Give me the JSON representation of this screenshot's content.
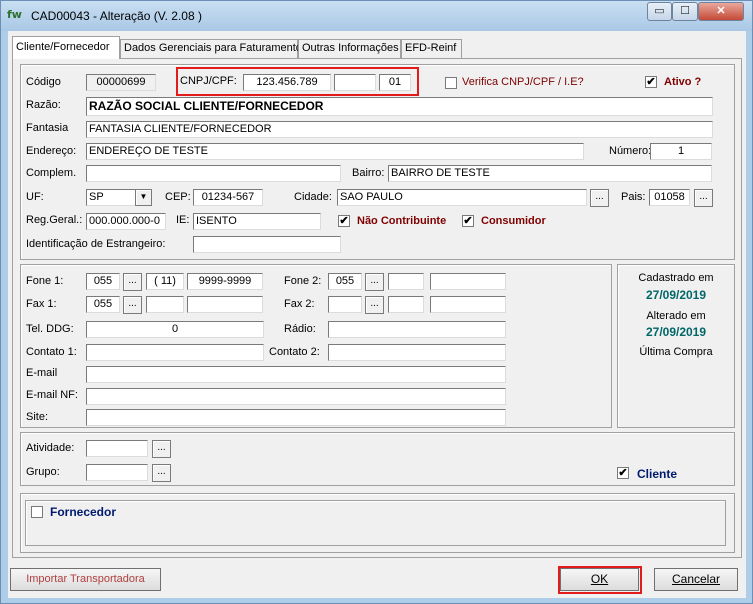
{
  "window": {
    "title": "CAD00043 - Alteração  (V.  2.08 )",
    "app_icon": "fw",
    "min": "▭",
    "max": "☐",
    "close": "✕"
  },
  "tabs": [
    "Cliente/Fornecedor",
    "Dados Gerenciais para Faturamento",
    "Outras Informações",
    "EFD-Reinf"
  ],
  "ident": {
    "codigo_label": "Código",
    "codigo": "00000699",
    "cnpj_label": "CNPJ/CPF:",
    "cnpj1": "123.456.789",
    "cnpj2": "",
    "cnpj3": "01",
    "verifica_label": "Verifica CNPJ/CPF / I.E?",
    "ativo_label": "Ativo ?",
    "razao_label": "Razão:",
    "razao": "RAZÃO SOCIAL CLIENTE/FORNECEDOR",
    "fantasia_label": "Fantasia",
    "fantasia": "FANTASIA CLIENTE/FORNECEDOR",
    "endereco_label": "Endereço:",
    "endereco": "ENDEREÇO DE TESTE",
    "numero_label": "Número:",
    "numero": "1",
    "complem_label": "Complem.",
    "complem": "",
    "bairro_label": "Bairro:",
    "bairro": "BAIRRO DE TESTE",
    "uf_label": "UF:",
    "uf": "SP",
    "cep_label": "CEP:",
    "cep": "01234-567",
    "cidade_label": "Cidade:",
    "cidade": "SAO PAULO",
    "pais_label": "Pais:",
    "pais": "01058",
    "rg_label": "Reg.Geral.:",
    "rg": "000.000.000-0",
    "ie_label": "IE:",
    "ie": "ISENTO",
    "nao_contrib_label": "Não Contribuinte",
    "consumidor_label": "Consumidor",
    "estrangeiro_label": "Identificação de Estrangeiro:",
    "estrangeiro": ""
  },
  "contact": {
    "fone1_label": "Fone 1:",
    "fone1_ddi": "055",
    "fone1_ddd": "( 11)",
    "fone1_num": "9999-9999",
    "fone2_label": "Fone 2:",
    "fone2_ddi": "055",
    "fax1_label": "Fax 1:",
    "fax1_ddi": "055",
    "fax2_label": "Fax 2:",
    "ddg_label": "Tel. DDG:",
    "ddg": "0",
    "radio_label": "Rádio:",
    "contato1_label": "Contato 1:",
    "contato2_label": "Contato 2:",
    "email_label": "E-mail",
    "emailnf_label": "E-mail NF:",
    "site_label": "Site:"
  },
  "dates": {
    "cadastrado_label": "Cadastrado em",
    "cadastrado": "27/09/2019",
    "alterado_label": "Alterado em",
    "alterado": "27/09/2019",
    "ultima_label": "Última Compra"
  },
  "classif": {
    "atividade_label": "Atividade:",
    "grupo_label": "Grupo:",
    "cliente_label": "Cliente",
    "fornecedor_label": "Fornecedor"
  },
  "buttons": {
    "importar": "Importar Transportadora",
    "ok": "OK",
    "cancelar": "Cancelar",
    "lookup": "...",
    "dropdown": "▼",
    "check": "✔"
  }
}
